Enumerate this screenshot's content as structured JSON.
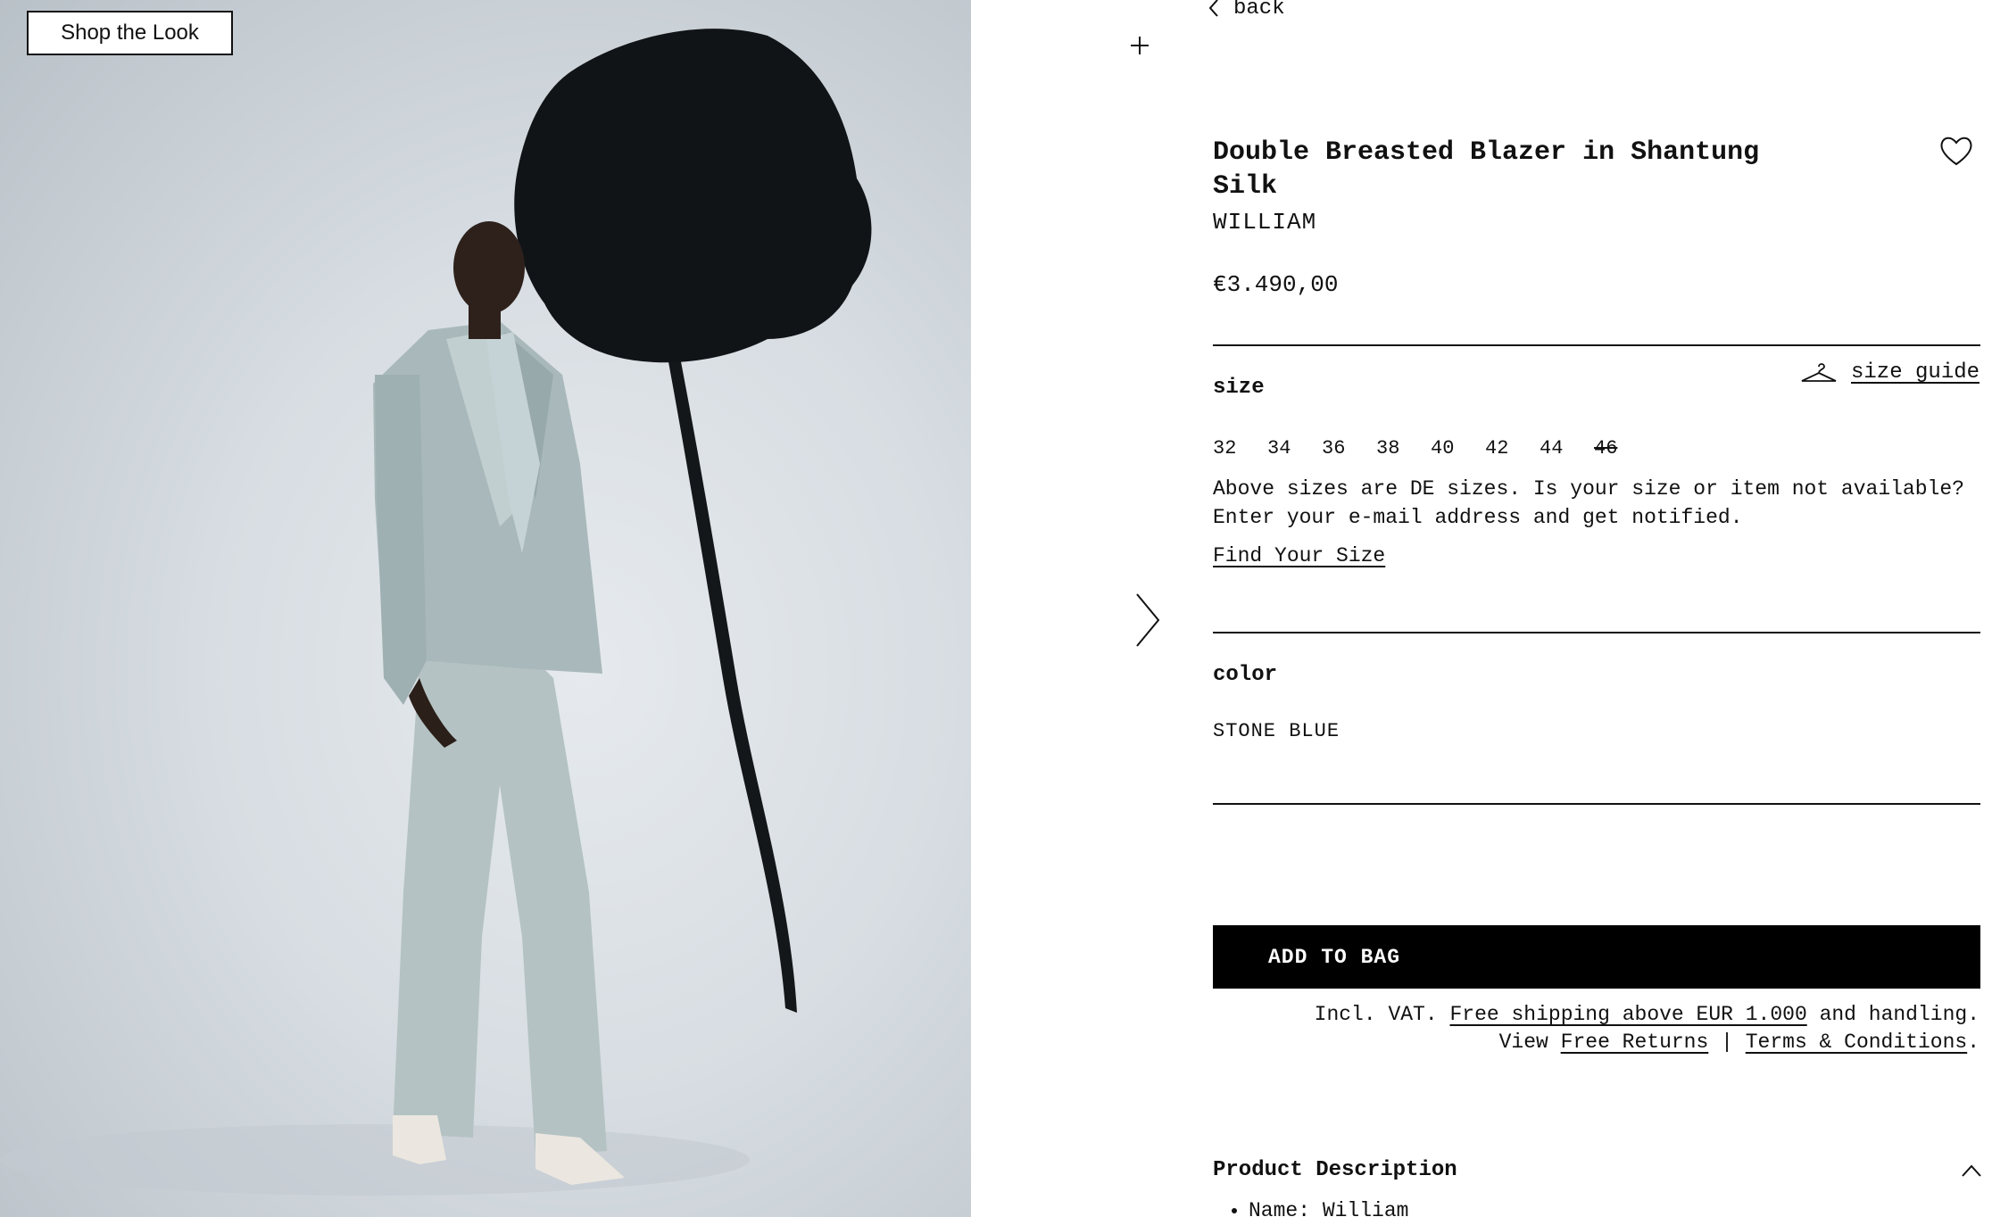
{
  "hero": {
    "shop_the_look_label": "Shop the Look"
  },
  "nav": {
    "back_label": "back"
  },
  "product": {
    "title": "Double Breasted Blazer in Shantung Silk",
    "brand": "WILLIAM",
    "price": "€3.490,00"
  },
  "size": {
    "heading": "size",
    "guide_label": "size guide",
    "options": [
      {
        "label": "32",
        "available": true
      },
      {
        "label": "34",
        "available": true
      },
      {
        "label": "36",
        "available": true
      },
      {
        "label": "38",
        "available": true
      },
      {
        "label": "40",
        "available": true
      },
      {
        "label": "42",
        "available": true
      },
      {
        "label": "44",
        "available": true
      },
      {
        "label": "46",
        "available": false
      }
    ],
    "note": "Above sizes are DE sizes. Is your size or item not available? Enter your e-mail address and get notified.",
    "find_size_label": "Find Your Size"
  },
  "color": {
    "heading": "color",
    "value": "STONE BLUE"
  },
  "cart": {
    "add_to_bag_label": "ADD TO BAG"
  },
  "shipping": {
    "vat_prefix": "Incl. VAT.",
    "free_shipping_link": "Free shipping above EUR 1.000",
    "vat_suffix": "and handling.",
    "view_prefix": "View",
    "free_returns_link": "Free Returns",
    "separator": "|",
    "terms_link": "Terms & Conditions",
    "terms_suffix": "."
  },
  "description": {
    "heading": "Product Description",
    "items": [
      "Name: William"
    ]
  },
  "icons": {
    "plus": "plus-icon",
    "next": "chevron-right-icon",
    "back": "chevron-left-icon",
    "wishlist": "heart-icon",
    "size_guide": "hanger-icon",
    "collapse": "chevron-up-icon"
  },
  "colors": {
    "button_bg": "#000000",
    "text": "#111111",
    "background": "#ffffff"
  }
}
